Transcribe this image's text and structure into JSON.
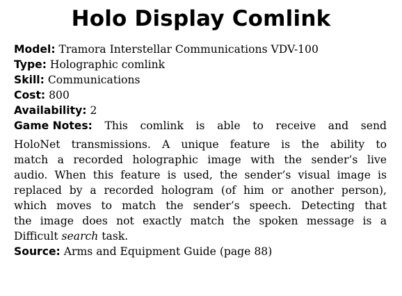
{
  "title": "Holo Display Comlink",
  "fields": {
    "model_label": "Model:",
    "model_value": "Tramora Interstellar Communications VDV-100",
    "type_label": "Type:",
    "type_value": "Holographic comlink",
    "skill_label": "Skill:",
    "skill_value": "Communications",
    "cost_label": "Cost:",
    "cost_value": "800",
    "availability_label": "Availability:",
    "availability_value": "2"
  },
  "game_notes": {
    "label": "Game Notes:",
    "first_line": [
      "This",
      "comlink",
      "is",
      "able",
      "to",
      "receive",
      "and",
      "send"
    ],
    "lines": [
      "HoloNet transmissions. A unique feature is the ability to",
      "match a recorded holographic image with the sender’s live",
      "audio. When this feature is used, the sender’s visual image is",
      "replaced by a recorded hologram (of him or another person),",
      "which moves to match the sender’s speech. Detecting that",
      "the image does not exactly match the spoken message is a"
    ],
    "last_line_pre": "Difficult ",
    "last_line_em": "search",
    "last_line_post": " task."
  },
  "source": {
    "label": "Source:",
    "value": "Arms and Equipment Guide (page 88)"
  }
}
